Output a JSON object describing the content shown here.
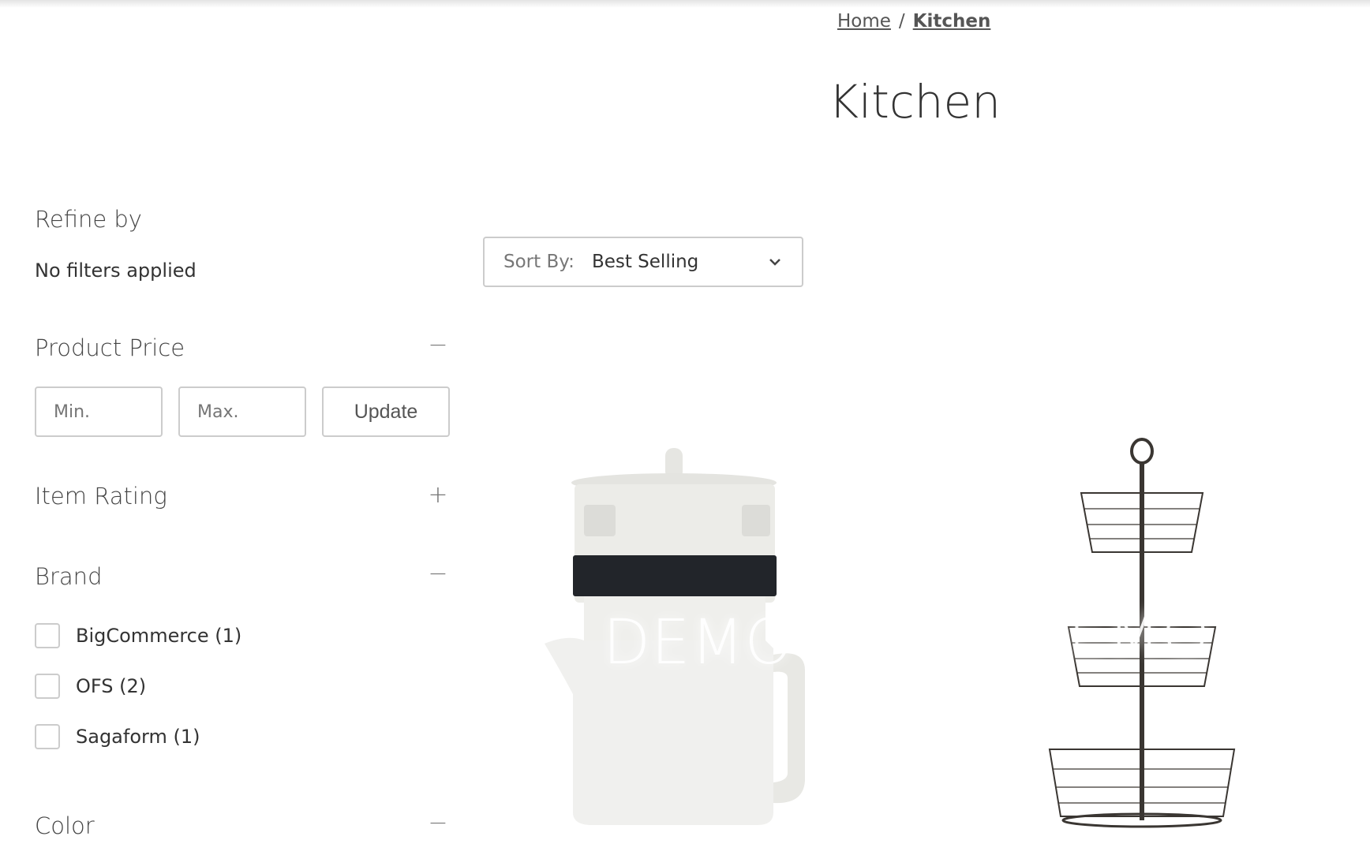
{
  "breadcrumb": {
    "items": [
      "Home",
      "Kitchen"
    ],
    "separator": "/"
  },
  "page": {
    "title": "Kitchen"
  },
  "sidebar": {
    "heading": "Refine by",
    "filters_status": "No filters applied",
    "sections": [
      {
        "label": "Product Price",
        "state": "expanded",
        "toggle": "−"
      },
      {
        "label": "Item Rating",
        "state": "collapsed",
        "toggle": "+"
      },
      {
        "label": "Brand",
        "state": "expanded",
        "toggle": "−"
      },
      {
        "label": "Color",
        "state": "expanded",
        "toggle": "−"
      }
    ],
    "price": {
      "min_placeholder": "Min.",
      "max_placeholder": "Max.",
      "min_value": "",
      "max_value": "",
      "update_label": "Update"
    },
    "brands": [
      {
        "label": "BigCommerce (1)",
        "checked": false
      },
      {
        "label": "OFS (2)",
        "checked": false
      },
      {
        "label": "Sagaform (1)",
        "checked": false
      }
    ]
  },
  "sort": {
    "label": "Sort By:",
    "value": "Best Selling",
    "icon": "chevron-down-icon"
  },
  "products": [
    {
      "image": "teapot-with-filter",
      "watermark": "DEMO"
    },
    {
      "image": "three-tier-wire-basket",
      "watermark": "DEMO"
    }
  ]
}
